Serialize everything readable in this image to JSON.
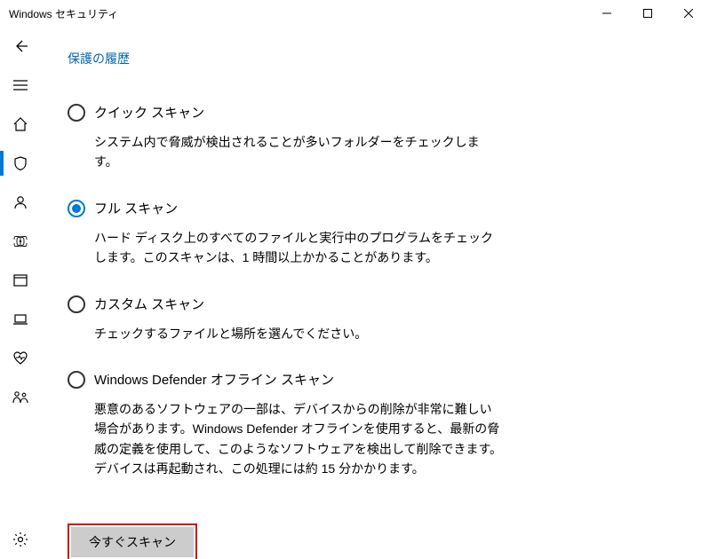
{
  "window": {
    "title": "Windows セキュリティ"
  },
  "links": {
    "protection_history": "保護の履歴"
  },
  "options": {
    "quick": {
      "title": "クイック スキャン",
      "desc": "システム内で脅威が検出されることが多いフォルダーをチェックします。"
    },
    "full": {
      "title": "フル スキャン",
      "desc": "ハード ディスク上のすべてのファイルと実行中のプログラムをチェックします。このスキャンは、1 時間以上かかることがあります。"
    },
    "custom": {
      "title": "カスタム スキャン",
      "desc": "チェックするファイルと場所を選んでください。"
    },
    "offline": {
      "title": "Windows Defender オフライン スキャン",
      "desc": "悪意のあるソフトウェアの一部は、デバイスからの削除が非常に難しい場合があります。Windows Defender オフラインを使用すると、最新の脅威の定義を使用して、このようなソフトウェアを検出して削除できます。デバイスは再起動され、この処理には約 15 分かかります。"
    }
  },
  "buttons": {
    "scan_now": "今すぐスキャン"
  },
  "selected_option": "full",
  "accent_color": "#0078d4",
  "highlight_color": "#d40000"
}
